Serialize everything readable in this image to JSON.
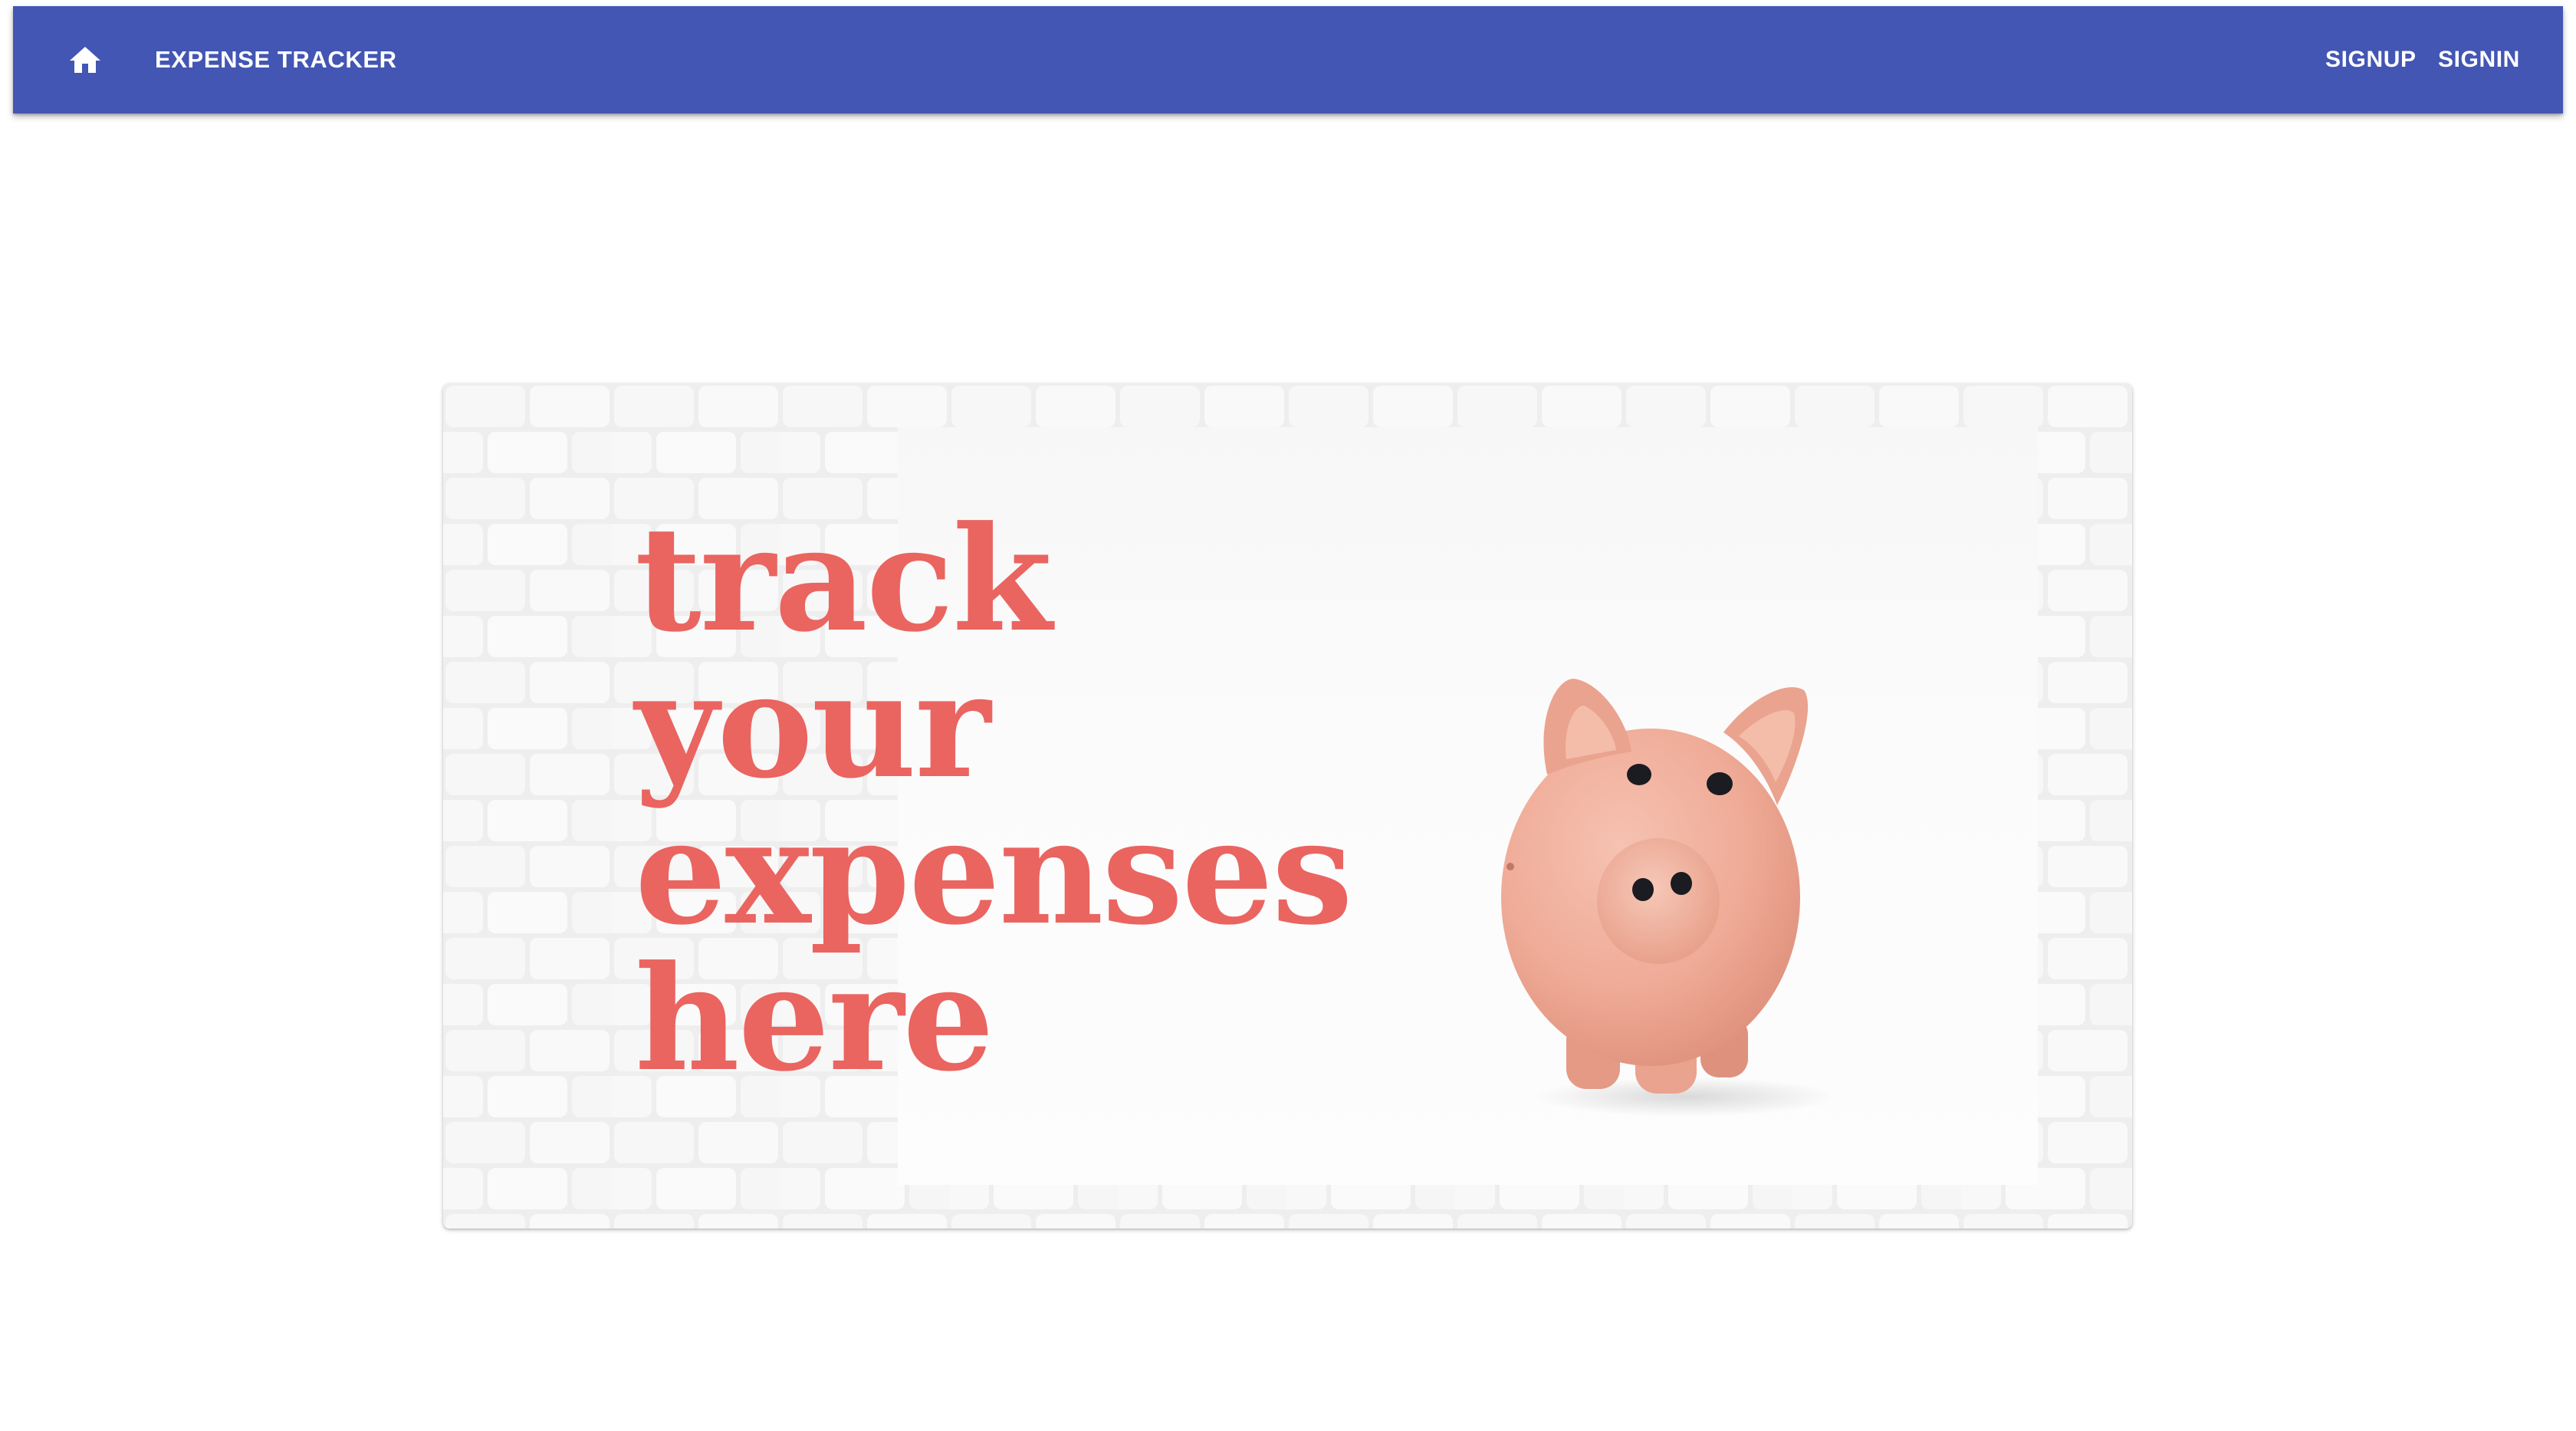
{
  "appbar": {
    "home_icon": "home-icon",
    "title": "EXPENSE TRACKER",
    "signup_label": "SIGNUP",
    "signin_label": "SIGNIN",
    "color": "#4356b4"
  },
  "hero": {
    "tagline_lines": [
      "track",
      "your",
      "expenses",
      "here"
    ],
    "tagline_color": "#ea6460",
    "image_subject": "piggy-bank-illustration"
  }
}
